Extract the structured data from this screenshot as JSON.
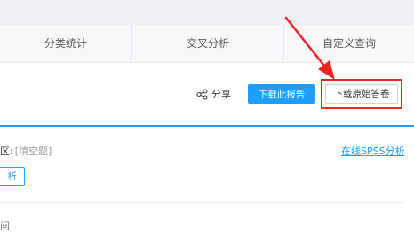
{
  "tabs": [
    {
      "label": "分类统计"
    },
    {
      "label": "交叉分析"
    },
    {
      "label": "自定义查询"
    }
  ],
  "actions": {
    "share_label": "分享",
    "share_icon": "share-icon",
    "download_report_label": "下载此报告",
    "download_raw_label": "下载原始答卷"
  },
  "question": {
    "title_fragment": "区:",
    "type_label": "[填空题]",
    "spss_link": "在线SPSS分析",
    "analyze_button_fragment": "析"
  },
  "next_question": {
    "fragment": "间"
  },
  "colors": {
    "accent": "#1e9fff",
    "annotation": "#e8261f"
  }
}
